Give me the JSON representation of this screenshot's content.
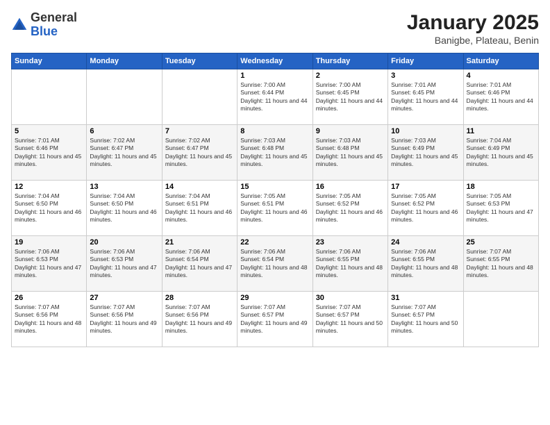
{
  "logo": {
    "general": "General",
    "blue": "Blue"
  },
  "header": {
    "month": "January 2025",
    "location": "Banigbe, Plateau, Benin"
  },
  "weekdays": [
    "Sunday",
    "Monday",
    "Tuesday",
    "Wednesday",
    "Thursday",
    "Friday",
    "Saturday"
  ],
  "weeks": [
    [
      {
        "day": "",
        "info": ""
      },
      {
        "day": "",
        "info": ""
      },
      {
        "day": "",
        "info": ""
      },
      {
        "day": "1",
        "info": "Sunrise: 7:00 AM\nSunset: 6:44 PM\nDaylight: 11 hours and 44 minutes."
      },
      {
        "day": "2",
        "info": "Sunrise: 7:00 AM\nSunset: 6:45 PM\nDaylight: 11 hours and 44 minutes."
      },
      {
        "day": "3",
        "info": "Sunrise: 7:01 AM\nSunset: 6:45 PM\nDaylight: 11 hours and 44 minutes."
      },
      {
        "day": "4",
        "info": "Sunrise: 7:01 AM\nSunset: 6:46 PM\nDaylight: 11 hours and 44 minutes."
      }
    ],
    [
      {
        "day": "5",
        "info": "Sunrise: 7:01 AM\nSunset: 6:46 PM\nDaylight: 11 hours and 45 minutes."
      },
      {
        "day": "6",
        "info": "Sunrise: 7:02 AM\nSunset: 6:47 PM\nDaylight: 11 hours and 45 minutes."
      },
      {
        "day": "7",
        "info": "Sunrise: 7:02 AM\nSunset: 6:47 PM\nDaylight: 11 hours and 45 minutes."
      },
      {
        "day": "8",
        "info": "Sunrise: 7:03 AM\nSunset: 6:48 PM\nDaylight: 11 hours and 45 minutes."
      },
      {
        "day": "9",
        "info": "Sunrise: 7:03 AM\nSunset: 6:48 PM\nDaylight: 11 hours and 45 minutes."
      },
      {
        "day": "10",
        "info": "Sunrise: 7:03 AM\nSunset: 6:49 PM\nDaylight: 11 hours and 45 minutes."
      },
      {
        "day": "11",
        "info": "Sunrise: 7:04 AM\nSunset: 6:49 PM\nDaylight: 11 hours and 45 minutes."
      }
    ],
    [
      {
        "day": "12",
        "info": "Sunrise: 7:04 AM\nSunset: 6:50 PM\nDaylight: 11 hours and 46 minutes."
      },
      {
        "day": "13",
        "info": "Sunrise: 7:04 AM\nSunset: 6:50 PM\nDaylight: 11 hours and 46 minutes."
      },
      {
        "day": "14",
        "info": "Sunrise: 7:04 AM\nSunset: 6:51 PM\nDaylight: 11 hours and 46 minutes."
      },
      {
        "day": "15",
        "info": "Sunrise: 7:05 AM\nSunset: 6:51 PM\nDaylight: 11 hours and 46 minutes."
      },
      {
        "day": "16",
        "info": "Sunrise: 7:05 AM\nSunset: 6:52 PM\nDaylight: 11 hours and 46 minutes."
      },
      {
        "day": "17",
        "info": "Sunrise: 7:05 AM\nSunset: 6:52 PM\nDaylight: 11 hours and 46 minutes."
      },
      {
        "day": "18",
        "info": "Sunrise: 7:05 AM\nSunset: 6:53 PM\nDaylight: 11 hours and 47 minutes."
      }
    ],
    [
      {
        "day": "19",
        "info": "Sunrise: 7:06 AM\nSunset: 6:53 PM\nDaylight: 11 hours and 47 minutes."
      },
      {
        "day": "20",
        "info": "Sunrise: 7:06 AM\nSunset: 6:53 PM\nDaylight: 11 hours and 47 minutes."
      },
      {
        "day": "21",
        "info": "Sunrise: 7:06 AM\nSunset: 6:54 PM\nDaylight: 11 hours and 47 minutes."
      },
      {
        "day": "22",
        "info": "Sunrise: 7:06 AM\nSunset: 6:54 PM\nDaylight: 11 hours and 48 minutes."
      },
      {
        "day": "23",
        "info": "Sunrise: 7:06 AM\nSunset: 6:55 PM\nDaylight: 11 hours and 48 minutes."
      },
      {
        "day": "24",
        "info": "Sunrise: 7:06 AM\nSunset: 6:55 PM\nDaylight: 11 hours and 48 minutes."
      },
      {
        "day": "25",
        "info": "Sunrise: 7:07 AM\nSunset: 6:55 PM\nDaylight: 11 hours and 48 minutes."
      }
    ],
    [
      {
        "day": "26",
        "info": "Sunrise: 7:07 AM\nSunset: 6:56 PM\nDaylight: 11 hours and 48 minutes."
      },
      {
        "day": "27",
        "info": "Sunrise: 7:07 AM\nSunset: 6:56 PM\nDaylight: 11 hours and 49 minutes."
      },
      {
        "day": "28",
        "info": "Sunrise: 7:07 AM\nSunset: 6:56 PM\nDaylight: 11 hours and 49 minutes."
      },
      {
        "day": "29",
        "info": "Sunrise: 7:07 AM\nSunset: 6:57 PM\nDaylight: 11 hours and 49 minutes."
      },
      {
        "day": "30",
        "info": "Sunrise: 7:07 AM\nSunset: 6:57 PM\nDaylight: 11 hours and 50 minutes."
      },
      {
        "day": "31",
        "info": "Sunrise: 7:07 AM\nSunset: 6:57 PM\nDaylight: 11 hours and 50 minutes."
      },
      {
        "day": "",
        "info": ""
      }
    ]
  ]
}
